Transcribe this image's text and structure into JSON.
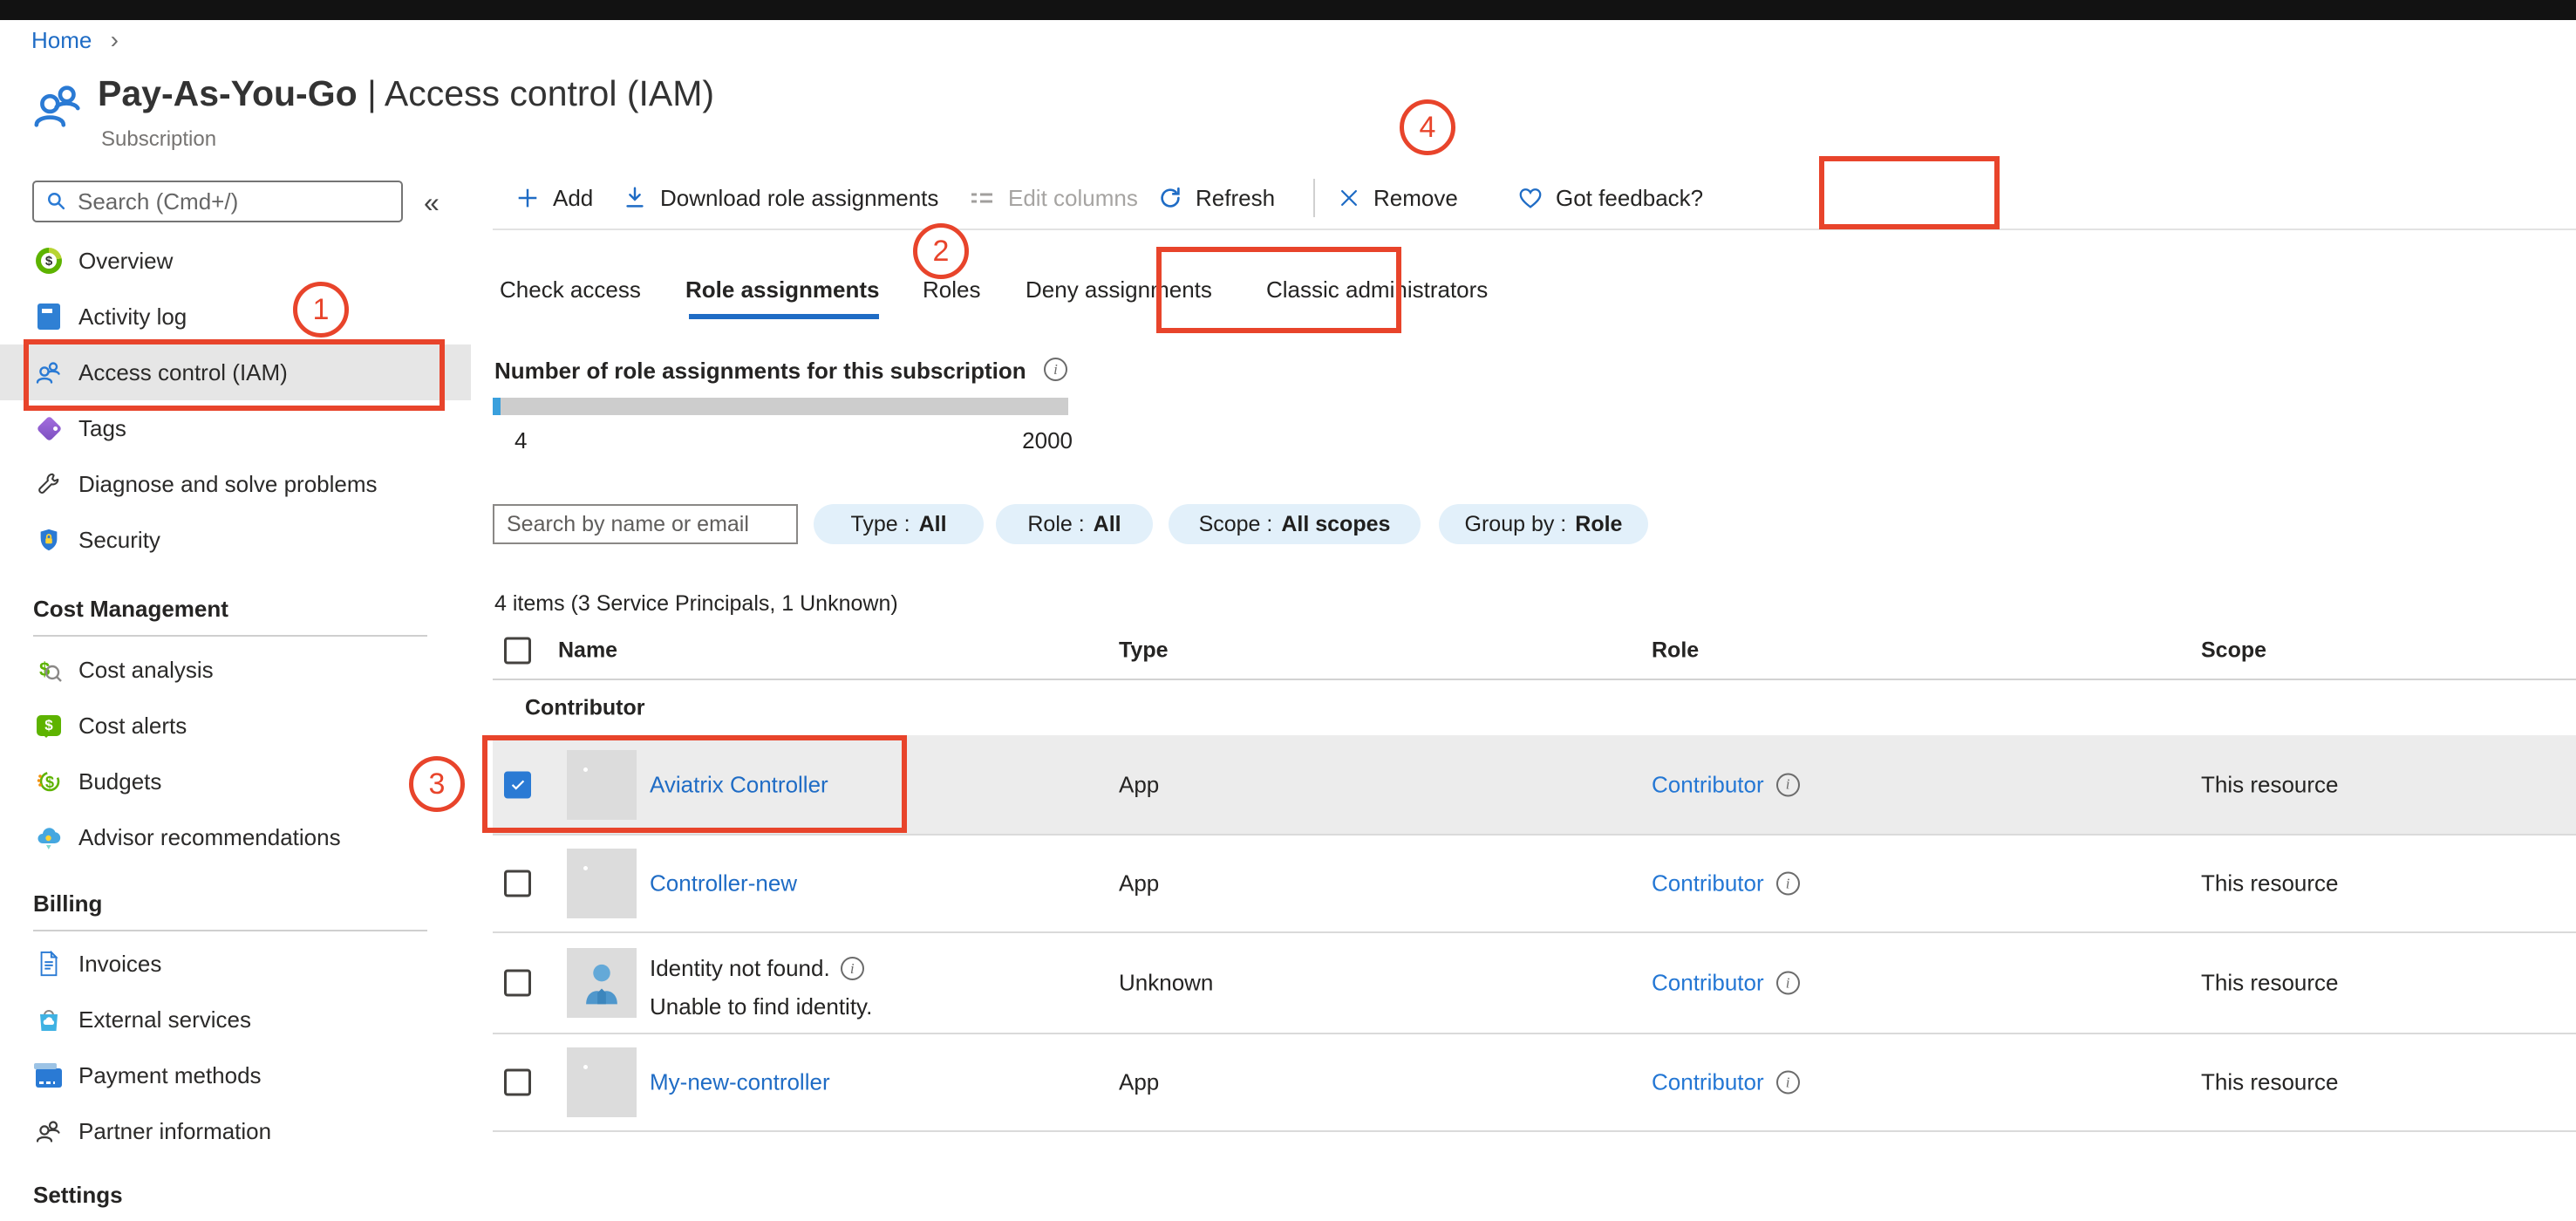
{
  "breadcrumb": {
    "home": "Home",
    "chevron": "›"
  },
  "header": {
    "title_name": "Pay-As-You-Go",
    "title_divider": "|",
    "title_section": "Access control (IAM)",
    "subtitle": "Subscription"
  },
  "sidebar": {
    "search_placeholder": "Search (Cmd+/)",
    "collapse_glyph": "«",
    "nav_main": [
      {
        "label": "Overview",
        "icon": "overview-donut-icon"
      },
      {
        "label": "Activity log",
        "icon": "activity-log-icon"
      },
      {
        "label": "Access control (IAM)",
        "icon": "people-icon",
        "selected": true
      },
      {
        "label": "Tags",
        "icon": "tag-icon"
      },
      {
        "label": "Diagnose and solve problems",
        "icon": "wrench-icon"
      },
      {
        "label": "Security",
        "icon": "shield-icon"
      }
    ],
    "sections": [
      {
        "title": "Cost Management",
        "items": [
          {
            "label": "Cost analysis",
            "icon": "cost-analysis-icon"
          },
          {
            "label": "Cost alerts",
            "icon": "cost-alerts-icon"
          },
          {
            "label": "Budgets",
            "icon": "budgets-icon"
          },
          {
            "label": "Advisor recommendations",
            "icon": "advisor-icon"
          }
        ]
      },
      {
        "title": "Billing",
        "items": [
          {
            "label": "Invoices",
            "icon": "invoice-icon"
          },
          {
            "label": "External services",
            "icon": "external-services-icon"
          },
          {
            "label": "Payment methods",
            "icon": "payment-card-icon"
          },
          {
            "label": "Partner information",
            "icon": "partner-people-icon"
          }
        ]
      },
      {
        "title": "Settings",
        "items": []
      }
    ]
  },
  "toolbar": {
    "add": "Add",
    "download": "Download role assignments",
    "edit_columns": "Edit columns",
    "refresh": "Refresh",
    "remove": "Remove",
    "feedback": "Got feedback?"
  },
  "tabs": {
    "check_access": "Check access",
    "role_assignments": "Role assignments",
    "roles": "Roles",
    "deny_assignments": "Deny assignments",
    "classic_admins": "Classic administrators"
  },
  "meter": {
    "label": "Number of role assignments for this subscription",
    "current": "4",
    "limit": "2000"
  },
  "filters": {
    "search_placeholder": "Search by name or email",
    "pills": [
      {
        "label": "Type :",
        "value": "All"
      },
      {
        "label": "Role :",
        "value": "All"
      },
      {
        "label": "Scope :",
        "value": "All scopes"
      },
      {
        "label": "Group by :",
        "value": "Role"
      }
    ]
  },
  "summary": "4 items (3 Service Principals, 1 Unknown)",
  "table": {
    "columns": {
      "name": "Name",
      "type": "Type",
      "role": "Role",
      "scope": "Scope"
    },
    "group_label": "Contributor",
    "rows": [
      {
        "name": "Aviatrix Controller",
        "type": "App",
        "role": "Contributor",
        "scope": "This resource",
        "checked": true,
        "selected": true,
        "avatar": "app"
      },
      {
        "name": "Controller-new",
        "type": "App",
        "role": "Contributor",
        "scope": "This resource",
        "checked": false,
        "avatar": "app"
      },
      {
        "name": "Identity not found.",
        "name_sub": "Unable to find identity.",
        "type": "Unknown",
        "role": "Contributor",
        "scope": "This resource",
        "checked": false,
        "avatar": "person"
      },
      {
        "name": "My-new-controller",
        "type": "App",
        "role": "Contributor",
        "scope": "This resource",
        "checked": false,
        "avatar": "app"
      }
    ]
  },
  "annotations": {
    "step1": "1",
    "step2": "2",
    "step3": "3",
    "step4": "4"
  },
  "colors": {
    "accent": "#0078d4",
    "link": "#1f6cc5",
    "annotation_red": "#e8442b",
    "pill_bg": "#e2f0fa",
    "selected_row_bg": "#ececec",
    "tab_underline": "#1f6cc5"
  }
}
